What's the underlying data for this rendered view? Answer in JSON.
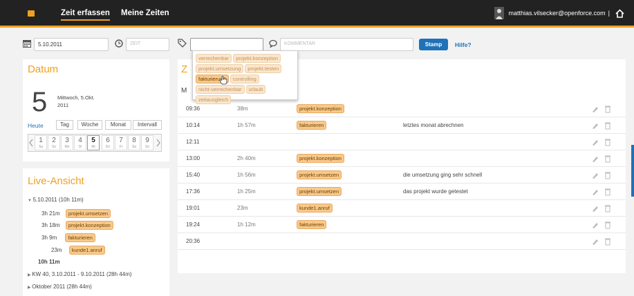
{
  "nav": {
    "tabs": [
      {
        "label": "Zeit erfassen"
      },
      {
        "label": "Meine Zeiten"
      }
    ],
    "user": "matthias.vilsecker@openforce.com",
    "separator": "|"
  },
  "toolbar": {
    "date_value": "5.10.2011",
    "time_placeholder": "ZEIT",
    "tag_value": "",
    "comment_placeholder": "KOMMENTAR",
    "stamp_label": "Stamp",
    "help_label": "Hilfe?"
  },
  "dropdown": {
    "tags": [
      "verrechenbar",
      "projekt.konzeption",
      "projekt.umsetzung",
      "projekt.testen",
      "fakturierung",
      "controlling",
      "nicht-verrechenbar",
      "urlaub",
      "zeitausgleich"
    ],
    "highlighted": "fakturierung"
  },
  "datum": {
    "title": "Datum",
    "day_number": "5",
    "weekday_line": "Mittwoch, 5.Okt.",
    "year_line": "2011",
    "today_label": "Heute",
    "views": [
      "Tag",
      "Woche",
      "Monat",
      "Intervall"
    ],
    "week_days": [
      {
        "n": "1",
        "w": "Sa"
      },
      {
        "n": "2",
        "w": "So"
      },
      {
        "n": "3",
        "w": "Mo"
      },
      {
        "n": "4",
        "w": "Di"
      },
      {
        "n": "5",
        "w": "Mi"
      },
      {
        "n": "6",
        "w": "Do"
      },
      {
        "n": "7",
        "w": "Fr"
      },
      {
        "n": "8",
        "w": "Sa"
      },
      {
        "n": "9",
        "w": "So"
      }
    ],
    "selected_day": "5"
  },
  "live": {
    "title": "Live-Ansicht",
    "day_header": "5.10.2011 (10h 11m)",
    "entries": [
      {
        "duration": "3h 21m",
        "tag": "projekt.umsetzen"
      },
      {
        "duration": "3h 18m",
        "tag": "projekt.konzeption"
      },
      {
        "duration": "3h 9m",
        "tag": "fakturieren"
      },
      {
        "duration": "23m",
        "tag": "kunde1.anruf"
      }
    ],
    "total": "10h 11m",
    "week": "KW 40, 3.10.2011 - 9.10.2011 (28h 44m)",
    "month": "Oktober 2011 (28h 44m)"
  },
  "main": {
    "title_fragment": "Z",
    "header_fragment_left": "M",
    "header_fragment_right": ")",
    "rows": [
      {
        "time": "09:36",
        "duration": "38m",
        "tag": "projekt.konzeption",
        "comment": ""
      },
      {
        "time": "10:14",
        "duration": "1h 57m",
        "tag": "fakturieren",
        "comment": "letztes monat abrechnen"
      },
      {
        "time": "12:11",
        "duration": "",
        "tag": "",
        "comment": ""
      },
      {
        "time": "13:00",
        "duration": "2h 40m",
        "tag": "projekt.konzeption",
        "comment": ""
      },
      {
        "time": "15:40",
        "duration": "1h 56m",
        "tag": "projekt.umsetzen",
        "comment": "die umsetzung ging sehr schnell"
      },
      {
        "time": "17:36",
        "duration": "1h 25m",
        "tag": "projekt.umsetzen",
        "comment": "das projekt wurde getestet"
      },
      {
        "time": "19:01",
        "duration": "23m",
        "tag": "kunde1.anruf",
        "comment": ""
      },
      {
        "time": "19:24",
        "duration": "1h 12m",
        "tag": "fakturieren",
        "comment": ""
      },
      {
        "time": "20:36",
        "duration": "",
        "tag": "",
        "comment": ""
      }
    ]
  },
  "colors": {
    "accent": "#f0a020",
    "link": "#1f72b8",
    "topbar": "#222222"
  }
}
